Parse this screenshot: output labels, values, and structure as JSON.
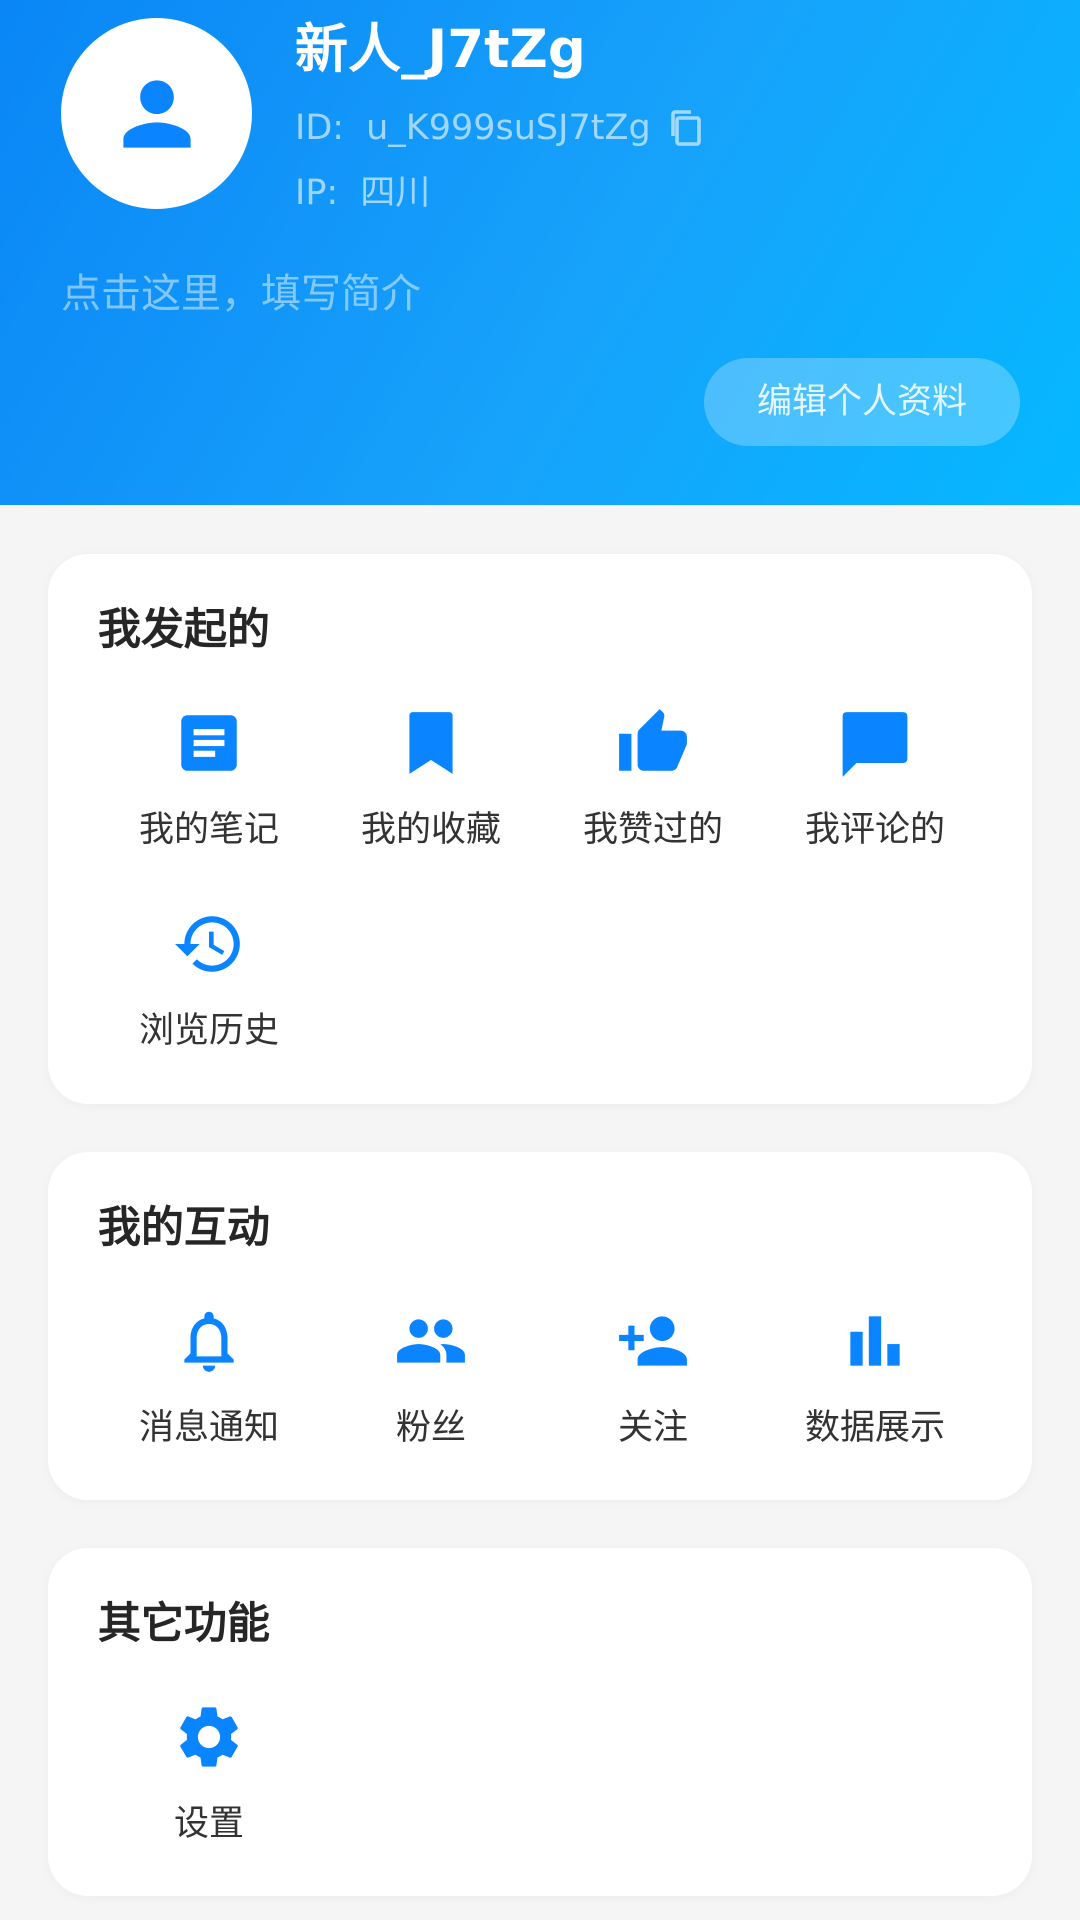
{
  "profile": {
    "username": "新人_J7tZg",
    "id_label": "ID:",
    "id_value": "u_K999suSJ7tZg",
    "ip_label": "IP:",
    "ip_value": "四川",
    "bio_placeholder": "点击这里，填写简介",
    "edit_button": "编辑个人资料",
    "avatar_icon": "person-icon",
    "copy_icon": "copy-icon"
  },
  "sections": {
    "initiated": {
      "title": "我发起的",
      "items": [
        {
          "label": "我的笔记",
          "icon": "notes-icon"
        },
        {
          "label": "我的收藏",
          "icon": "bookmark-icon"
        },
        {
          "label": "我赞过的",
          "icon": "thumb-up-icon"
        },
        {
          "label": "我评论的",
          "icon": "comment-icon"
        },
        {
          "label": "浏览历史",
          "icon": "history-icon"
        }
      ]
    },
    "interaction": {
      "title": "我的互动",
      "items": [
        {
          "label": "消息通知",
          "icon": "bell-icon"
        },
        {
          "label": "粉丝",
          "icon": "fans-icon"
        },
        {
          "label": "关注",
          "icon": "add-person-icon"
        },
        {
          "label": "数据展示",
          "icon": "bar-chart-icon"
        }
      ]
    },
    "other": {
      "title": "其它功能",
      "items": [
        {
          "label": "设置",
          "icon": "gear-icon"
        }
      ]
    }
  },
  "colors": {
    "accent": "#0a84ff",
    "header_gradient_start": "#0a86f6",
    "header_gradient_end": "#05b8ff",
    "background": "#f5f5f5"
  }
}
